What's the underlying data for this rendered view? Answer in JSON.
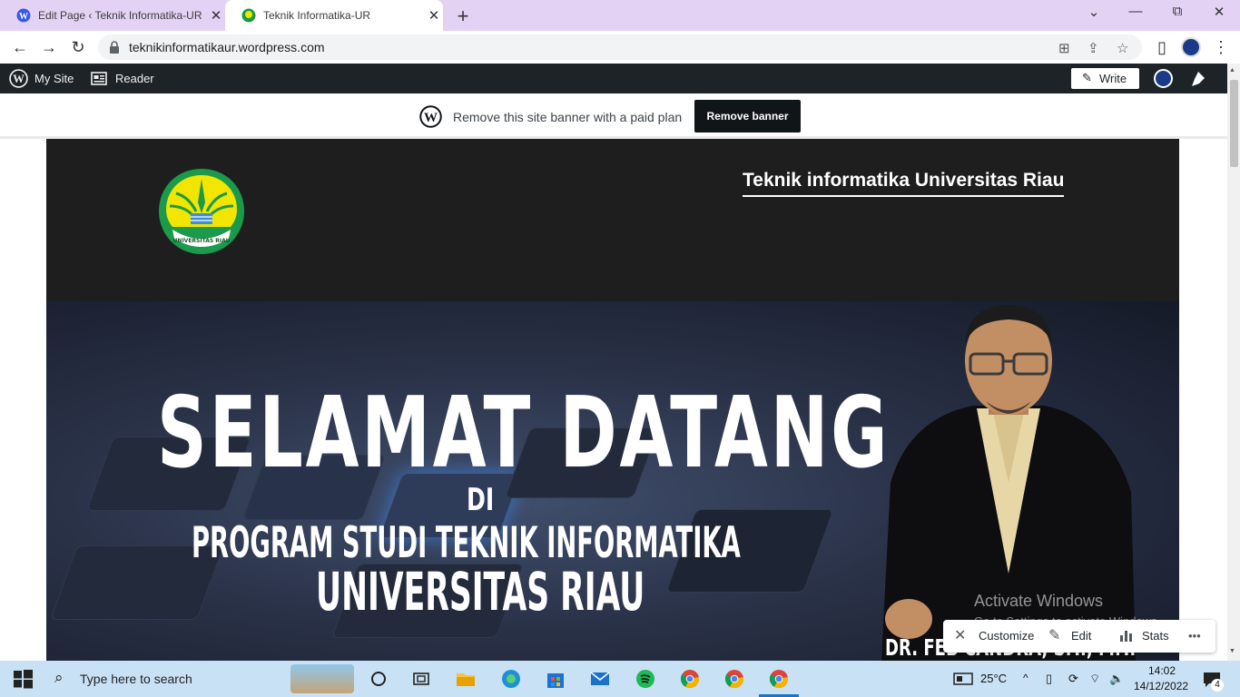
{
  "browser": {
    "tabs": [
      {
        "title": "Edit Page ‹ Teknik Informatika-UR",
        "active": false
      },
      {
        "title": "Teknik Informatika-UR",
        "active": true
      }
    ],
    "new_tab": "+",
    "window_controls": {
      "dropdown": "⌄",
      "minimize": "—",
      "restore": "⧉",
      "close": "✕"
    },
    "url": "teknikinformatikaur.wordpress.com"
  },
  "wp_admin_bar": {
    "my_site": "My Site",
    "reader": "Reader",
    "write": "Write"
  },
  "banner": {
    "message": "Remove this site banner with a paid plan",
    "button": "Remove banner"
  },
  "site": {
    "logo_text": "UNIVERSITAS RIAU",
    "title": "Teknik informatika Universitas Riau",
    "hero": {
      "line1": "SELAMAT DATANG",
      "line2": "DI",
      "line3": "PROGRAM STUDI TEKNIK INFORMATIKA",
      "line4": "UNIVERSITAS RIAU",
      "caption": "DR. FEB CANDRA, S.T., M.T."
    }
  },
  "activation": {
    "title": "Activate Windows",
    "subtitle": "Go to Settings to activate Windows."
  },
  "floating_toolbar": {
    "customize": "Customize",
    "edit": "Edit",
    "stats": "Stats",
    "more": "•••"
  },
  "taskbar": {
    "search_placeholder": "Type here to search",
    "weather": "25°C",
    "time": "14:02",
    "date": "14/12/2022",
    "notification_count": "4"
  },
  "colors": {
    "tab_strip": "#e4d2f5",
    "wp_bar": "#1d2327",
    "site_bg": "#1e1e1e",
    "taskbar": "#c9e1f5",
    "logo_green": "#1a9a4a",
    "logo_yellow": "#f2e600"
  }
}
